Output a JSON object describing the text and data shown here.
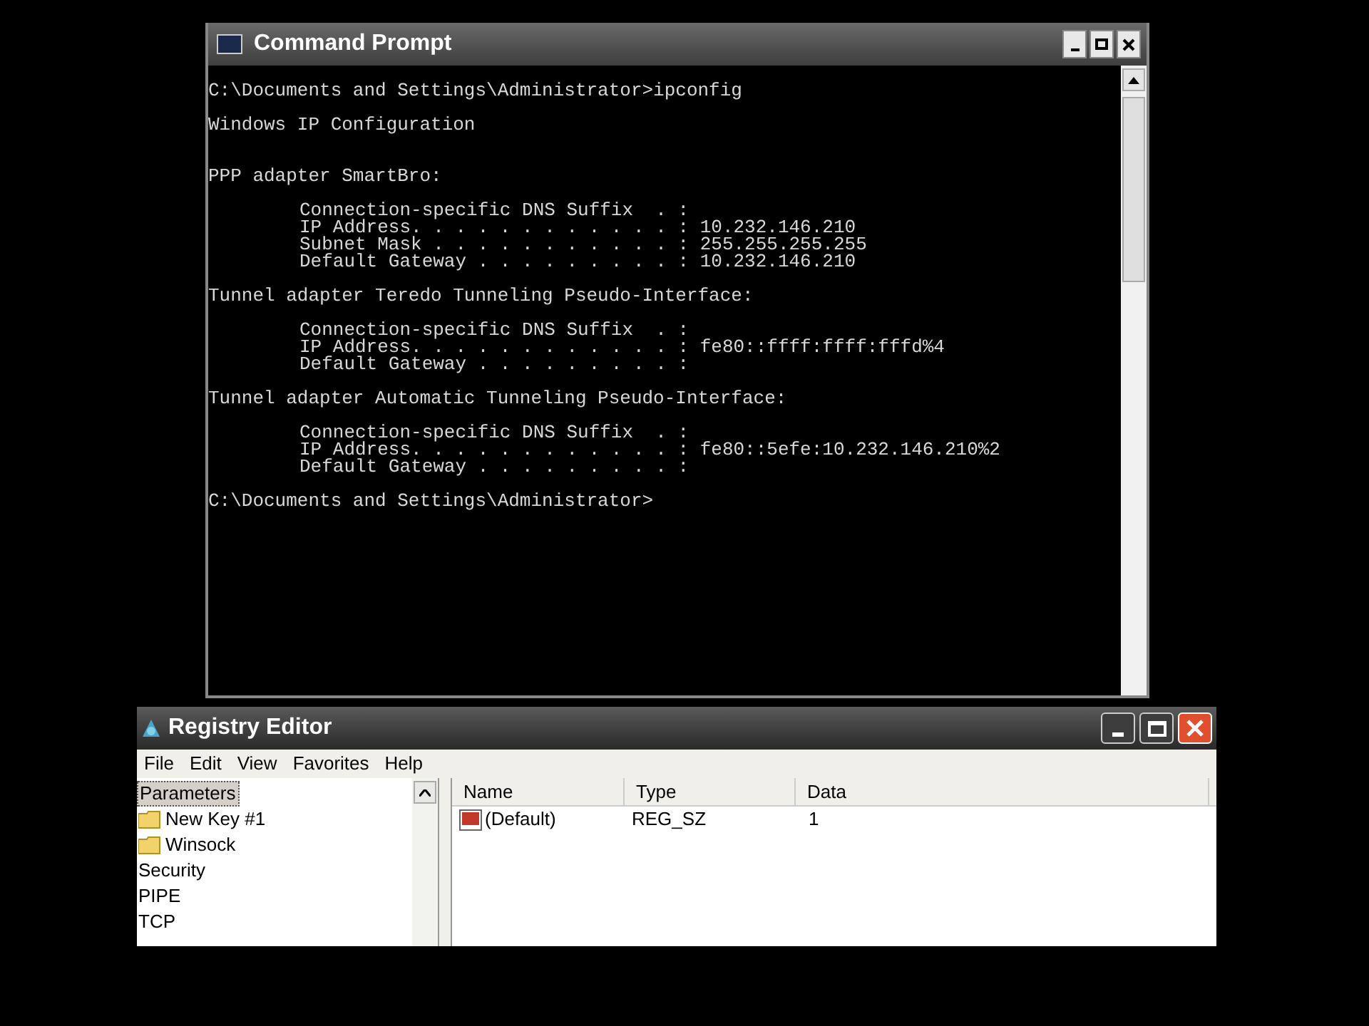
{
  "console_window": {
    "title": "Command Prompt",
    "blocks": [
      {
        "kind": "heading",
        "lines": [
          "C:\\Documents and Settings\\Administrator>ipconfig"
        ]
      },
      {
        "kind": "heading",
        "lines": [
          "Windows IP Configuration"
        ]
      },
      {
        "kind": "heading",
        "lines": [
          "PPP adapter SmartBro:"
        ]
      },
      {
        "kind": "detail",
        "lines": [
          "Connection-specific DNS Suffix  . :",
          "IP Address. . . . . . . . . . . . : 10.232.146.210",
          "Subnet Mask . . . . . . . . . . . : 255.255.255.255",
          "Default Gateway . . . . . . . . . : 10.232.146.210"
        ]
      },
      {
        "kind": "heading",
        "lines": [
          "Tunnel adapter Teredo Tunneling Pseudo-Interface:"
        ]
      },
      {
        "kind": "detail",
        "lines": [
          "Connection-specific DNS Suffix  . :",
          "IP Address. . . . . . . . . . . . : fe80::ffff:ffff:fffd%4",
          "Default Gateway . . . . . . . . . :"
        ]
      },
      {
        "kind": "heading",
        "lines": [
          "Tunnel adapter Automatic Tunneling Pseudo-Interface:"
        ]
      },
      {
        "kind": "detail",
        "lines": [
          "Connection-specific DNS Suffix  . :",
          "IP Address. . . . . . . . . . . . : fe80::5efe:10.232.146.210%2",
          "Default Gateway . . . . . . . . . :"
        ]
      },
      {
        "kind": "heading",
        "lines": [
          "C:\\Documents and Settings\\Administrator>"
        ]
      }
    ]
  },
  "registry_window": {
    "title": "Registry Editor",
    "menu": [
      "File",
      "Edit",
      "View",
      "Favorites",
      "Help"
    ],
    "tree": [
      {
        "label": "Parameters",
        "kind": "plain",
        "selected": true
      },
      {
        "label": "New Key #1",
        "kind": "folder",
        "selected": false
      },
      {
        "label": "Winsock",
        "kind": "folder",
        "selected": false
      },
      {
        "label": "Security",
        "kind": "plain",
        "selected": false
      },
      {
        "label": "PIPE",
        "kind": "plain",
        "selected": false
      },
      {
        "label": "TCP",
        "kind": "plain",
        "selected": false
      }
    ],
    "columns": [
      "Name",
      "Type",
      "Data"
    ],
    "rows": [
      {
        "name": "(Default)",
        "type": "REG_SZ",
        "data": "1"
      }
    ]
  }
}
